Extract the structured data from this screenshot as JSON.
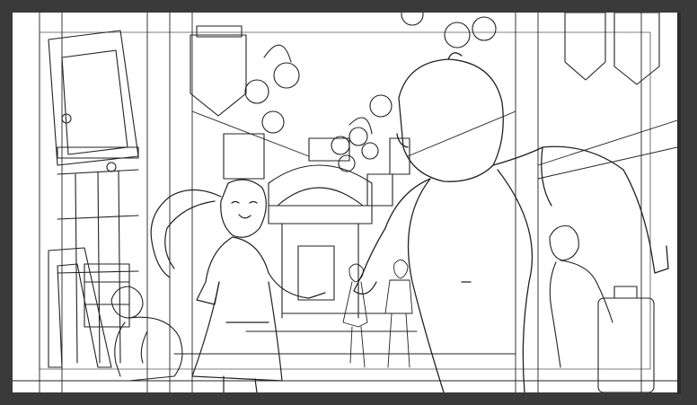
{
  "canvas": {
    "background_color": "#3a3a3a",
    "paper_color": "#ffffff",
    "ink_color": "#222222"
  },
  "scene": {
    "icons": [
      "storefront-icon",
      "street-lamp-icon",
      "hanging-sign-icon",
      "arch-gate-icon",
      "figure-icon"
    ]
  }
}
